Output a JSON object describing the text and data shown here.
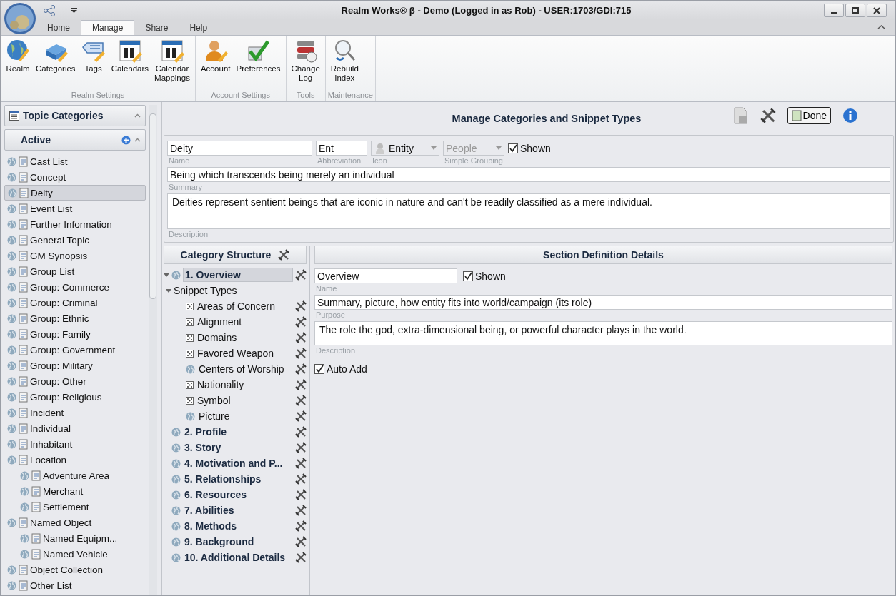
{
  "window": {
    "title": "Realm Works® β - Demo (Logged in as Rob) - USER:1703/GDI:715"
  },
  "ribbon_tabs": [
    {
      "label": "Home",
      "selected": false
    },
    {
      "label": "Manage",
      "selected": true
    },
    {
      "label": "Share",
      "selected": false
    },
    {
      "label": "Help",
      "selected": false
    }
  ],
  "ribbon_groups": [
    {
      "label": "Realm Settings",
      "buttons": [
        {
          "label": "Realm",
          "kind": "globe"
        },
        {
          "label": "Categories",
          "kind": "blocks"
        },
        {
          "label": "Tags",
          "kind": "tag"
        },
        {
          "label": "Calendars",
          "kind": "calendar"
        },
        {
          "label": "Calendar\nMappings",
          "kind": "calendar"
        }
      ]
    },
    {
      "label": "Account Settings",
      "buttons": [
        {
          "label": "Account",
          "kind": "person"
        },
        {
          "label": "Preferences",
          "kind": "check"
        }
      ]
    },
    {
      "label": "Tools",
      "buttons": [
        {
          "label": "Change\nLog",
          "kind": "database"
        }
      ]
    },
    {
      "label": "Maintenance",
      "buttons": [
        {
          "label": "Rebuild\nIndex",
          "kind": "search"
        }
      ]
    }
  ],
  "sidebar": {
    "title": "Topic Categories",
    "section": "Active",
    "items": [
      {
        "label": "Cast List",
        "selected": false
      },
      {
        "label": "Concept",
        "selected": false
      },
      {
        "label": "Deity",
        "selected": true
      },
      {
        "label": "Event List",
        "selected": false
      },
      {
        "label": "Further Information",
        "selected": false
      },
      {
        "label": "General Topic",
        "selected": false
      },
      {
        "label": "GM Synopsis",
        "selected": false
      },
      {
        "label": "Group List",
        "selected": false
      },
      {
        "label": "Group: Commerce",
        "selected": false
      },
      {
        "label": "Group: Criminal",
        "selected": false
      },
      {
        "label": "Group: Ethnic",
        "selected": false
      },
      {
        "label": "Group: Family",
        "selected": false
      },
      {
        "label": "Group: Government",
        "selected": false
      },
      {
        "label": "Group: Military",
        "selected": false
      },
      {
        "label": "Group: Other",
        "selected": false
      },
      {
        "label": "Group: Religious",
        "selected": false
      },
      {
        "label": "Incident",
        "selected": false
      },
      {
        "label": "Individual",
        "selected": false
      },
      {
        "label": "Inhabitant",
        "selected": false
      },
      {
        "label": "Location",
        "selected": false,
        "children": [
          {
            "label": "Adventure Area",
            "selected": false
          },
          {
            "label": "Merchant",
            "selected": false
          },
          {
            "label": "Settlement",
            "selected": false
          }
        ]
      },
      {
        "label": "Named Object",
        "selected": false,
        "children": [
          {
            "label": "Named Equipm...",
            "selected": false
          },
          {
            "label": "Named Vehicle",
            "selected": false
          }
        ]
      },
      {
        "label": "Object Collection",
        "selected": false
      },
      {
        "label": "Other List",
        "selected": false
      }
    ]
  },
  "header": {
    "title": "Manage Categories and Snippet Types",
    "done_button": "Done"
  },
  "category_form": {
    "name": {
      "value": "Deity",
      "label": "Name"
    },
    "abbreviation": {
      "value": "Ent",
      "label": "Abbreviation"
    },
    "icon": {
      "value": "Entity",
      "label": "Icon"
    },
    "simple_grouping": {
      "value": "People",
      "label": "Simple Grouping"
    },
    "shown": {
      "label": "Shown",
      "checked": true
    },
    "summary": {
      "value": "Being which transcends being merely an individual",
      "label": "Summary"
    },
    "description": {
      "value": "Deities represent sentient beings that are iconic in nature and can't be readily classified as a mere individual.",
      "label": "Description"
    }
  },
  "structure": {
    "title": "Category Structure",
    "sections": [
      {
        "label": "1. Overview",
        "selected": true,
        "children": [
          {
            "label": "Snippet Types",
            "children": [
              {
                "label": "Areas of Concern",
                "kind": "dice"
              },
              {
                "label": "Alignment",
                "kind": "dice"
              },
              {
                "label": "Domains",
                "kind": "dice"
              },
              {
                "label": "Favored Weapon",
                "kind": "dice"
              },
              {
                "label": "Centers of Worship",
                "kind": "globe"
              },
              {
                "label": "Nationality",
                "kind": "dice"
              },
              {
                "label": "Symbol",
                "kind": "dice"
              },
              {
                "label": "Picture",
                "kind": "globe"
              }
            ]
          }
        ]
      },
      {
        "label": "2. Profile",
        "selected": false
      },
      {
        "label": "3. Story",
        "selected": false
      },
      {
        "label": "4. Motivation and P...",
        "selected": false
      },
      {
        "label": "5. Relationships",
        "selected": false
      },
      {
        "label": "6. Resources",
        "selected": false
      },
      {
        "label": "7. Abilities",
        "selected": false
      },
      {
        "label": "8. Methods",
        "selected": false
      },
      {
        "label": "9. Background",
        "selected": false
      },
      {
        "label": "10. Additional Details",
        "selected": false
      }
    ]
  },
  "section_details": {
    "title": "Section Definition Details",
    "name": {
      "value": "Overview",
      "label": "Name"
    },
    "shown": {
      "label": "Shown",
      "checked": true
    },
    "purpose": {
      "value": "Summary, picture, how entity fits into world/campaign (its role)",
      "label": "Purpose"
    },
    "description": {
      "value": "The role the god, extra-dimensional being, or powerful character plays in the world.",
      "label": "Description"
    },
    "auto_add": {
      "label": "Auto Add",
      "checked": true
    }
  }
}
